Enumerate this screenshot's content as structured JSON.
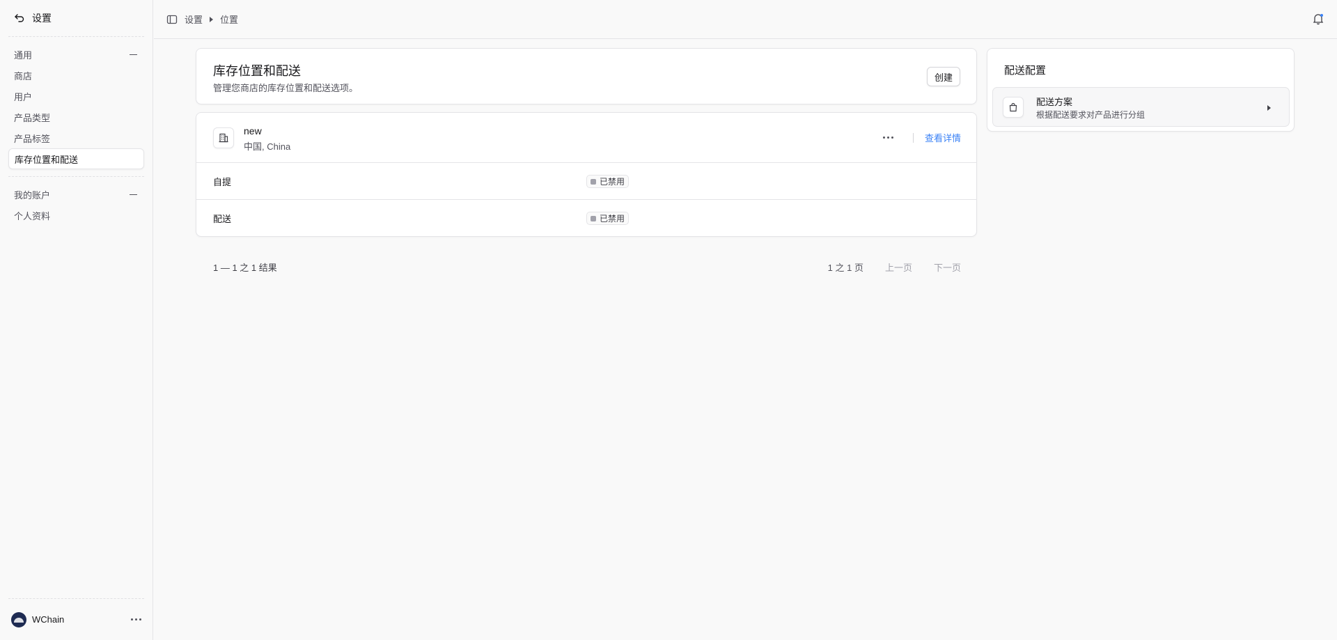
{
  "sidebar": {
    "header": {
      "label": "设置",
      "icon": "back-arrow-icon"
    },
    "sections": [
      {
        "title": "通用",
        "items": [
          "商店",
          "用户",
          "产品类型",
          "产品标签",
          "库存位置和配送"
        ]
      },
      {
        "title": "我的账户",
        "items": [
          "个人资料"
        ]
      }
    ],
    "active_item": "库存位置和配送",
    "footer": {
      "name": "WChain"
    }
  },
  "topbar": {
    "breadcrumb": [
      "设置",
      "位置"
    ]
  },
  "main": {
    "header": {
      "title": "库存位置和配送",
      "subtitle": "管理您商店的库存位置和配送选项。",
      "create_label": "创建"
    },
    "location": {
      "name": "new",
      "address": "中国, China",
      "view_details_label": "查看详情",
      "rows": [
        {
          "label": "自提",
          "status": "已禁用"
        },
        {
          "label": "配送",
          "status": "已禁用"
        }
      ]
    },
    "pagination": {
      "count_text": "1 — 1 之 1 结果",
      "page_text": "1 之 1 页",
      "prev_label": "上一页",
      "next_label": "下一页"
    }
  },
  "right_panel": {
    "title": "配送配置",
    "plan": {
      "title": "配送方案",
      "subtitle": "根据配送要求对产品进行分组"
    }
  },
  "colors": {
    "link": "#3b82f6",
    "status_disabled": "#a1a1aa"
  }
}
